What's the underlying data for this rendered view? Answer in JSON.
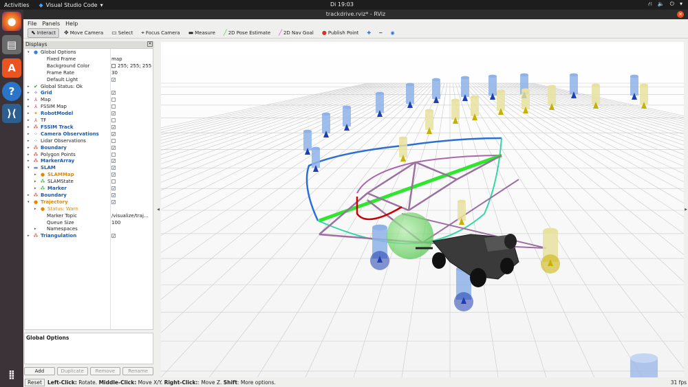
{
  "topbar": {
    "activities": "Activities",
    "app_name": "Visual Studio Code",
    "clock": "Di 19:03"
  },
  "window": {
    "title": "trackdrive.rviz* - RViz"
  },
  "menu": [
    "File",
    "Panels",
    "Help"
  ],
  "toolbar": [
    {
      "label": "Interact",
      "icon": "cursor-icon",
      "active": true
    },
    {
      "label": "Move Camera",
      "icon": "move-camera-icon"
    },
    {
      "label": "Select",
      "icon": "select-icon"
    },
    {
      "label": "Focus Camera",
      "icon": "focus-camera-icon"
    },
    {
      "label": "Measure",
      "icon": "measure-icon"
    },
    {
      "label": "2D Pose Estimate",
      "icon": "pose-estimate-icon"
    },
    {
      "label": "2D Nav Goal",
      "icon": "nav-goal-icon"
    },
    {
      "label": "Publish Point",
      "icon": "publish-point-icon"
    }
  ],
  "displays": {
    "title": "Displays",
    "rows": [
      {
        "label": "Global Options",
        "indent": 0,
        "arrow": "▾",
        "icon": "globe-icon",
        "iconColor": "#3b7dd8"
      },
      {
        "label": "Fixed Frame",
        "indent": 1,
        "value": "map"
      },
      {
        "label": "Background Color",
        "indent": 1,
        "value": "255; 255; 255",
        "swatch": true
      },
      {
        "label": "Frame Rate",
        "indent": 1,
        "value": "30"
      },
      {
        "label": "Default Light",
        "indent": 1,
        "check": true
      },
      {
        "label": "Global Status: Ok",
        "indent": 0,
        "arrow": "▸",
        "icon": "check-icon",
        "iconColor": "#1a9a1a"
      },
      {
        "label": "Grid",
        "indent": 0,
        "arrow": "▸",
        "icon": "grid-icon",
        "iconColor": "#555",
        "style": "blue",
        "check": true
      },
      {
        "label": "Map",
        "indent": 0,
        "arrow": "▸",
        "icon": "axes-icon",
        "iconColor": "#c03030",
        "check": false
      },
      {
        "label": "FSSIM Map",
        "indent": 0,
        "arrow": "▸",
        "icon": "axes-icon",
        "iconColor": "#c03030",
        "check": false
      },
      {
        "label": "RobotModel",
        "indent": 0,
        "arrow": "▸",
        "icon": "robot-icon",
        "iconColor": "#d9a020",
        "style": "blue",
        "check": true
      },
      {
        "label": "TF",
        "indent": 0,
        "arrow": "▸",
        "icon": "axes-icon",
        "iconColor": "#c03030",
        "check": false
      },
      {
        "label": "FSSIM Track",
        "indent": 0,
        "arrow": "▸",
        "icon": "marker-icon",
        "iconColor": "#c03030",
        "style": "blue",
        "check": true
      },
      {
        "label": "Camera Observations",
        "indent": 0,
        "arrow": "▸",
        "icon": "points-icon",
        "iconColor": "#3b7dd8",
        "style": "blue",
        "check": true
      },
      {
        "label": "Lidar Observations",
        "indent": 0,
        "arrow": "▸",
        "icon": "points-icon",
        "iconColor": "#3b7dd8",
        "check": false
      },
      {
        "label": "Boundary",
        "indent": 0,
        "arrow": "▸",
        "icon": "marker-icon",
        "iconColor": "#c03030",
        "style": "blue",
        "check": true
      },
      {
        "label": "Polygon Points",
        "indent": 0,
        "arrow": "▸",
        "icon": "marker-icon",
        "iconColor": "#c03030",
        "check": false
      },
      {
        "label": "MarkerArray",
        "indent": 0,
        "arrow": "▸",
        "icon": "marker-icon",
        "iconColor": "#c03030",
        "style": "blue",
        "check": true
      },
      {
        "label": "SLAM",
        "indent": 0,
        "arrow": "▾",
        "icon": "folder-icon",
        "iconColor": "#6e8fb8",
        "style": "blue",
        "check": true
      },
      {
        "label": "SLAMMap",
        "indent": 1,
        "arrow": "▸",
        "icon": "warning-icon",
        "iconColor": "#e08a00",
        "style": "orange",
        "check": true
      },
      {
        "label": "SLAMState",
        "indent": 1,
        "arrow": "▸",
        "icon": "marker-icon",
        "iconColor": "#1a9a1a",
        "check": false
      },
      {
        "label": "Marker",
        "indent": 1,
        "arrow": "▸",
        "icon": "marker-icon",
        "iconColor": "#1a9a1a",
        "style": "blue",
        "check": true
      },
      {
        "label": "Boundary",
        "indent": 0,
        "arrow": "▸",
        "icon": "marker-icon",
        "iconColor": "#c03030",
        "style": "blue",
        "check": true
      },
      {
        "label": "Trajectory",
        "indent": 0,
        "arrow": "▾",
        "icon": "warning-icon",
        "iconColor": "#e08a00",
        "style": "orange",
        "check": true
      },
      {
        "label": "Status: Warn",
        "indent": 1,
        "arrow": "▸",
        "icon": "warning-icon",
        "iconColor": "#e08a00",
        "style": "warn"
      },
      {
        "label": "Marker Topic",
        "indent": 1,
        "value": "/visualize/traj..."
      },
      {
        "label": "Queue Size",
        "indent": 1,
        "value": "100"
      },
      {
        "label": "Namespaces",
        "indent": 1,
        "arrow": "▸"
      },
      {
        "label": "Triangulation",
        "indent": 0,
        "arrow": "▸",
        "icon": "marker-icon",
        "iconColor": "#c03030",
        "style": "blue",
        "check": true
      }
    ]
  },
  "description": {
    "title": "Global Options"
  },
  "buttons": [
    {
      "label": "Add",
      "disabled": false
    },
    {
      "label": "Duplicate",
      "disabled": true
    },
    {
      "label": "Remove",
      "disabled": true
    },
    {
      "label": "Rename",
      "disabled": true
    }
  ],
  "status": {
    "reset": "Reset",
    "hint_parts": [
      {
        "t": "Left-Click:",
        "b": true
      },
      {
        "t": " Rotate. ",
        "b": false
      },
      {
        "t": "Middle-Click:",
        "b": true
      },
      {
        "t": " Move X/Y. ",
        "b": false
      },
      {
        "t": "Right-Click:",
        "b": true
      },
      {
        "t": ": Move Z. ",
        "b": false
      },
      {
        "t": "Shift",
        "b": true
      },
      {
        "t": ": More options.",
        "b": false
      }
    ],
    "fps": "31 fps"
  }
}
